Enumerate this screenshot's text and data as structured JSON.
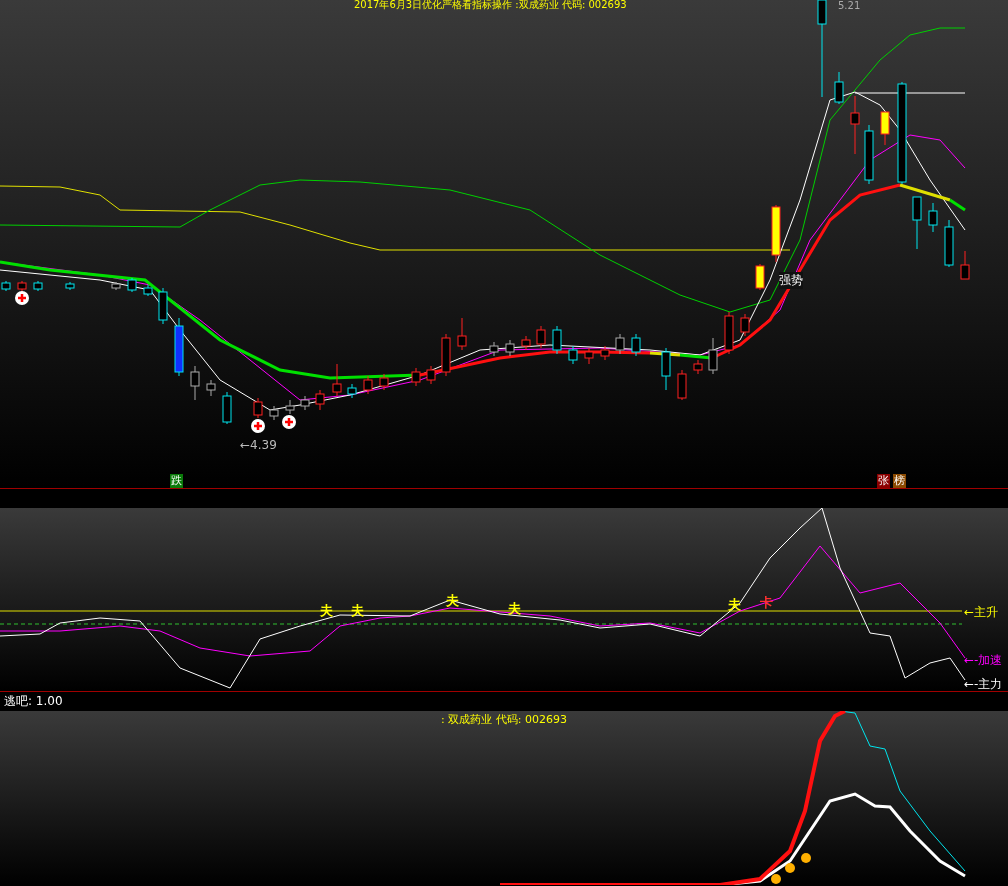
{
  "main_chart": {
    "title": "2017年6月3日优化严格看指标操作 :双成药业 代码: 002693",
    "high_label": "5.21",
    "low_label": "←4.39",
    "trend_label": "强势",
    "signals": [
      {
        "text": "跌",
        "kind": "fall"
      },
      {
        "text": "张",
        "kind": "rise"
      },
      {
        "text": "榜",
        "kind": "rank"
      }
    ]
  },
  "indicator_chart": {
    "marks": [
      {
        "text": "夫",
        "color": "#ffff00"
      },
      {
        "text": "夫",
        "color": "#ffff00"
      },
      {
        "text": "夫",
        "color": "#ffff00"
      },
      {
        "text": "夫",
        "color": "#ffff00"
      },
      {
        "text": "夫",
        "color": "#ffff00"
      },
      {
        "text": "卡",
        "color": "#ff3030"
      }
    ],
    "legend": [
      {
        "text": "←主升",
        "color": "#ffff00"
      },
      {
        "text": "←-加速",
        "color": "#ff00ff"
      },
      {
        "text": "←-主力",
        "color": "#ffffff"
      }
    ]
  },
  "readout": "逃吧: 1.00",
  "bottom_chart": {
    "title": ": 双成药业 代码: 002693"
  }
}
